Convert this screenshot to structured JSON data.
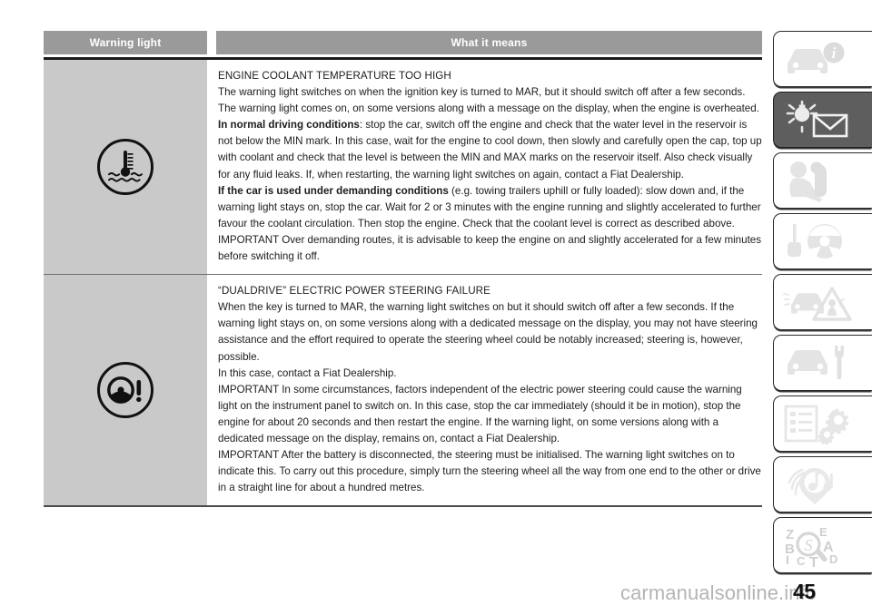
{
  "page": {
    "number": "45",
    "watermark": "carmanualsonline.info"
  },
  "table": {
    "headers": {
      "warning_light": "Warning light",
      "what_it_means": "What it means"
    },
    "rows": [
      {
        "icon_name": "coolant-temperature-warning-light",
        "title": "ENGINE COOLANT TEMPERATURE TOO HIGH",
        "paragraphs": [
          {
            "bold_lead": "",
            "text": "The warning light switches on when the ignition key is turned to MAR, but it should switch off after a few seconds."
          },
          {
            "bold_lead": "",
            "text": "The warning light comes on, on some versions along with a message on the display, when the engine is overheated."
          },
          {
            "bold_lead": "In normal driving conditions",
            "text": ": stop the car, switch off the engine and check that the water level in the reservoir is not below the MIN mark. In this case, wait for the engine to cool down, then slowly and carefully open the cap, top up with coolant and check that the level is between the MIN and MAX marks on the reservoir itself. Also check visually for any fluid leaks. If, when restarting, the warning light switches on again, contact a Fiat Dealership."
          },
          {
            "bold_lead": "If the car is used under demanding conditions",
            "text": " (e.g. towing trailers uphill or fully loaded): slow down and, if the warning light stays on, stop the car. Wait for 2 or 3 minutes with the engine running and slightly accelerated to further favour the coolant circulation. Then stop the engine. Check that the coolant level is correct as described above."
          },
          {
            "bold_lead": "",
            "text": "IMPORTANT Over demanding routes, it is advisable to keep the engine on and slightly accelerated for a few minutes before switching it off."
          }
        ]
      },
      {
        "icon_name": "electric-power-steering-warning-light",
        "title": "“DUALDRIVE” ELECTRIC POWER STEERING FAILURE",
        "paragraphs": [
          {
            "bold_lead": "",
            "text": "When the key is turned to MAR, the warning light switches on but it should switch off after a few seconds. If the warning light stays on, on some versions along with a dedicated message on the display, you may not have steering assistance and the effort required to operate the steering wheel could be notably increased; steering is, however, possible."
          },
          {
            "bold_lead": "",
            "text": "In this case, contact a Fiat Dealership."
          },
          {
            "bold_lead": "",
            "text": "IMPORTANT In some circumstances, factors independent of the electric power steering could cause the warning light on the instrument panel to switch on. In this case, stop the car immediately (should it be in motion), stop the engine for about 20 seconds and then restart the engine. If the warning light, on some versions along with a dedicated message on the display, remains on, contact a Fiat Dealership."
          },
          {
            "bold_lead": "",
            "text": "IMPORTANT After the battery is disconnected, the steering must be initialised. The warning light switches on to indicate this. To carry out this procedure, simply turn the steering wheel all the way from one end to the other or drive in a straight line for about a hundred metres."
          }
        ]
      }
    ]
  },
  "sidebar": {
    "tabs": [
      {
        "icon": "car-info-icon",
        "label": "Dashboard and controls",
        "active": false
      },
      {
        "icon": "warning-lamp-message-icon",
        "label": "Warning lights and messages",
        "active": true
      },
      {
        "icon": "child-seat-safety-icon",
        "label": "Safety",
        "active": false
      },
      {
        "icon": "key-steering-wheel-icon",
        "label": "Starting and driving",
        "active": false
      },
      {
        "icon": "car-hazard-triangle-icon",
        "label": "In an emergency",
        "active": false
      },
      {
        "icon": "car-wrench-icon",
        "label": "Maintenance and care",
        "active": false
      },
      {
        "icon": "list-gears-icon",
        "label": "Technical specifications",
        "active": false
      },
      {
        "icon": "multimedia-navigation-icon",
        "label": "Multimedia",
        "active": false
      },
      {
        "icon": "alphabetical-index-icon",
        "label": "Alphabetical index",
        "active": false
      }
    ],
    "index_letters": [
      "Z",
      "B",
      "I",
      "C",
      "T",
      "E",
      "A",
      "D"
    ]
  },
  "colors": {
    "header_bg": "#9a9a9a",
    "icon_cell_bg": "#c9c9c9",
    "active_tab_bg": "#5e5e5e",
    "tab_icon_fill": "#e2e2e2",
    "rule": "#1b1b1b",
    "watermark": "#b4b4b4"
  }
}
